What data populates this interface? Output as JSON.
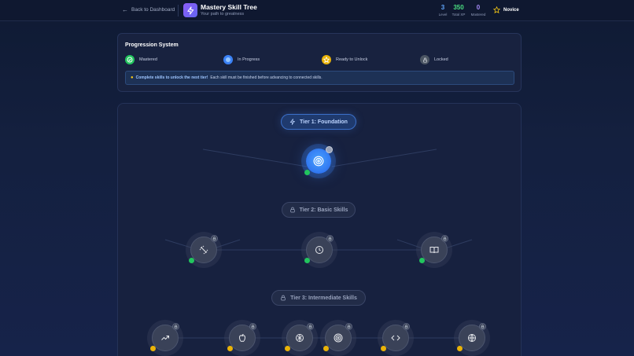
{
  "header": {
    "back_label": "Back to Dashboard",
    "title": "Mastery Skill Tree",
    "subtitle": "Your path to greatness",
    "stats": [
      {
        "value": "3",
        "label": "Level",
        "color": "#60a5fa"
      },
      {
        "value": "350",
        "label": "Total XP",
        "color": "#4ade80"
      },
      {
        "value": "0",
        "label": "Mastered",
        "color": "#a78bfa"
      }
    ],
    "rank": "Novice"
  },
  "progression": {
    "title": "Progression System",
    "legend": [
      {
        "label": "Mastered",
        "color": "#22c55e",
        "icon": "check-icon"
      },
      {
        "label": "In Progress",
        "color": "#3b82f6",
        "icon": "dot-icon"
      },
      {
        "label": "Ready to Unlock",
        "color": "#eab308",
        "icon": "star-icon"
      },
      {
        "label": "Locked",
        "color": "#4b5563",
        "icon": "lock-icon"
      }
    ],
    "info_bold": "Complete skills to unlock the next tier!",
    "info_text": "Each skill must be finished before advancing to connected skills."
  },
  "tiers": [
    {
      "label": "Tier 1: Foundation",
      "state": "active"
    },
    {
      "label": "Tier 2: Basic Skills",
      "state": "locked"
    },
    {
      "label": "Tier 3: Intermediate Skills",
      "state": "locked"
    }
  ],
  "nodes": {
    "tier1": [
      {
        "icon": "target-icon",
        "state": "in-progress",
        "status": "green"
      }
    ],
    "tier2": [
      {
        "icon": "dumbbell-icon",
        "state": "locked",
        "status": "green"
      },
      {
        "icon": "clock-icon",
        "state": "locked",
        "status": "green"
      },
      {
        "icon": "book-icon",
        "state": "locked",
        "status": "green"
      }
    ],
    "tier3": [
      {
        "icon": "trending-up-icon",
        "state": "locked",
        "status": "amber"
      },
      {
        "icon": "apple-icon",
        "state": "locked",
        "status": "amber"
      },
      {
        "icon": "brain-icon",
        "state": "locked",
        "status": "amber"
      },
      {
        "icon": "target-icon",
        "state": "locked",
        "status": "amber"
      },
      {
        "icon": "code-icon",
        "state": "locked",
        "status": "amber"
      },
      {
        "icon": "globe-icon",
        "state": "locked",
        "status": "amber"
      }
    ]
  },
  "colors": {
    "accent": "#3b82f6",
    "mastered": "#22c55e",
    "ready": "#eab308",
    "locked": "#4b5563"
  }
}
